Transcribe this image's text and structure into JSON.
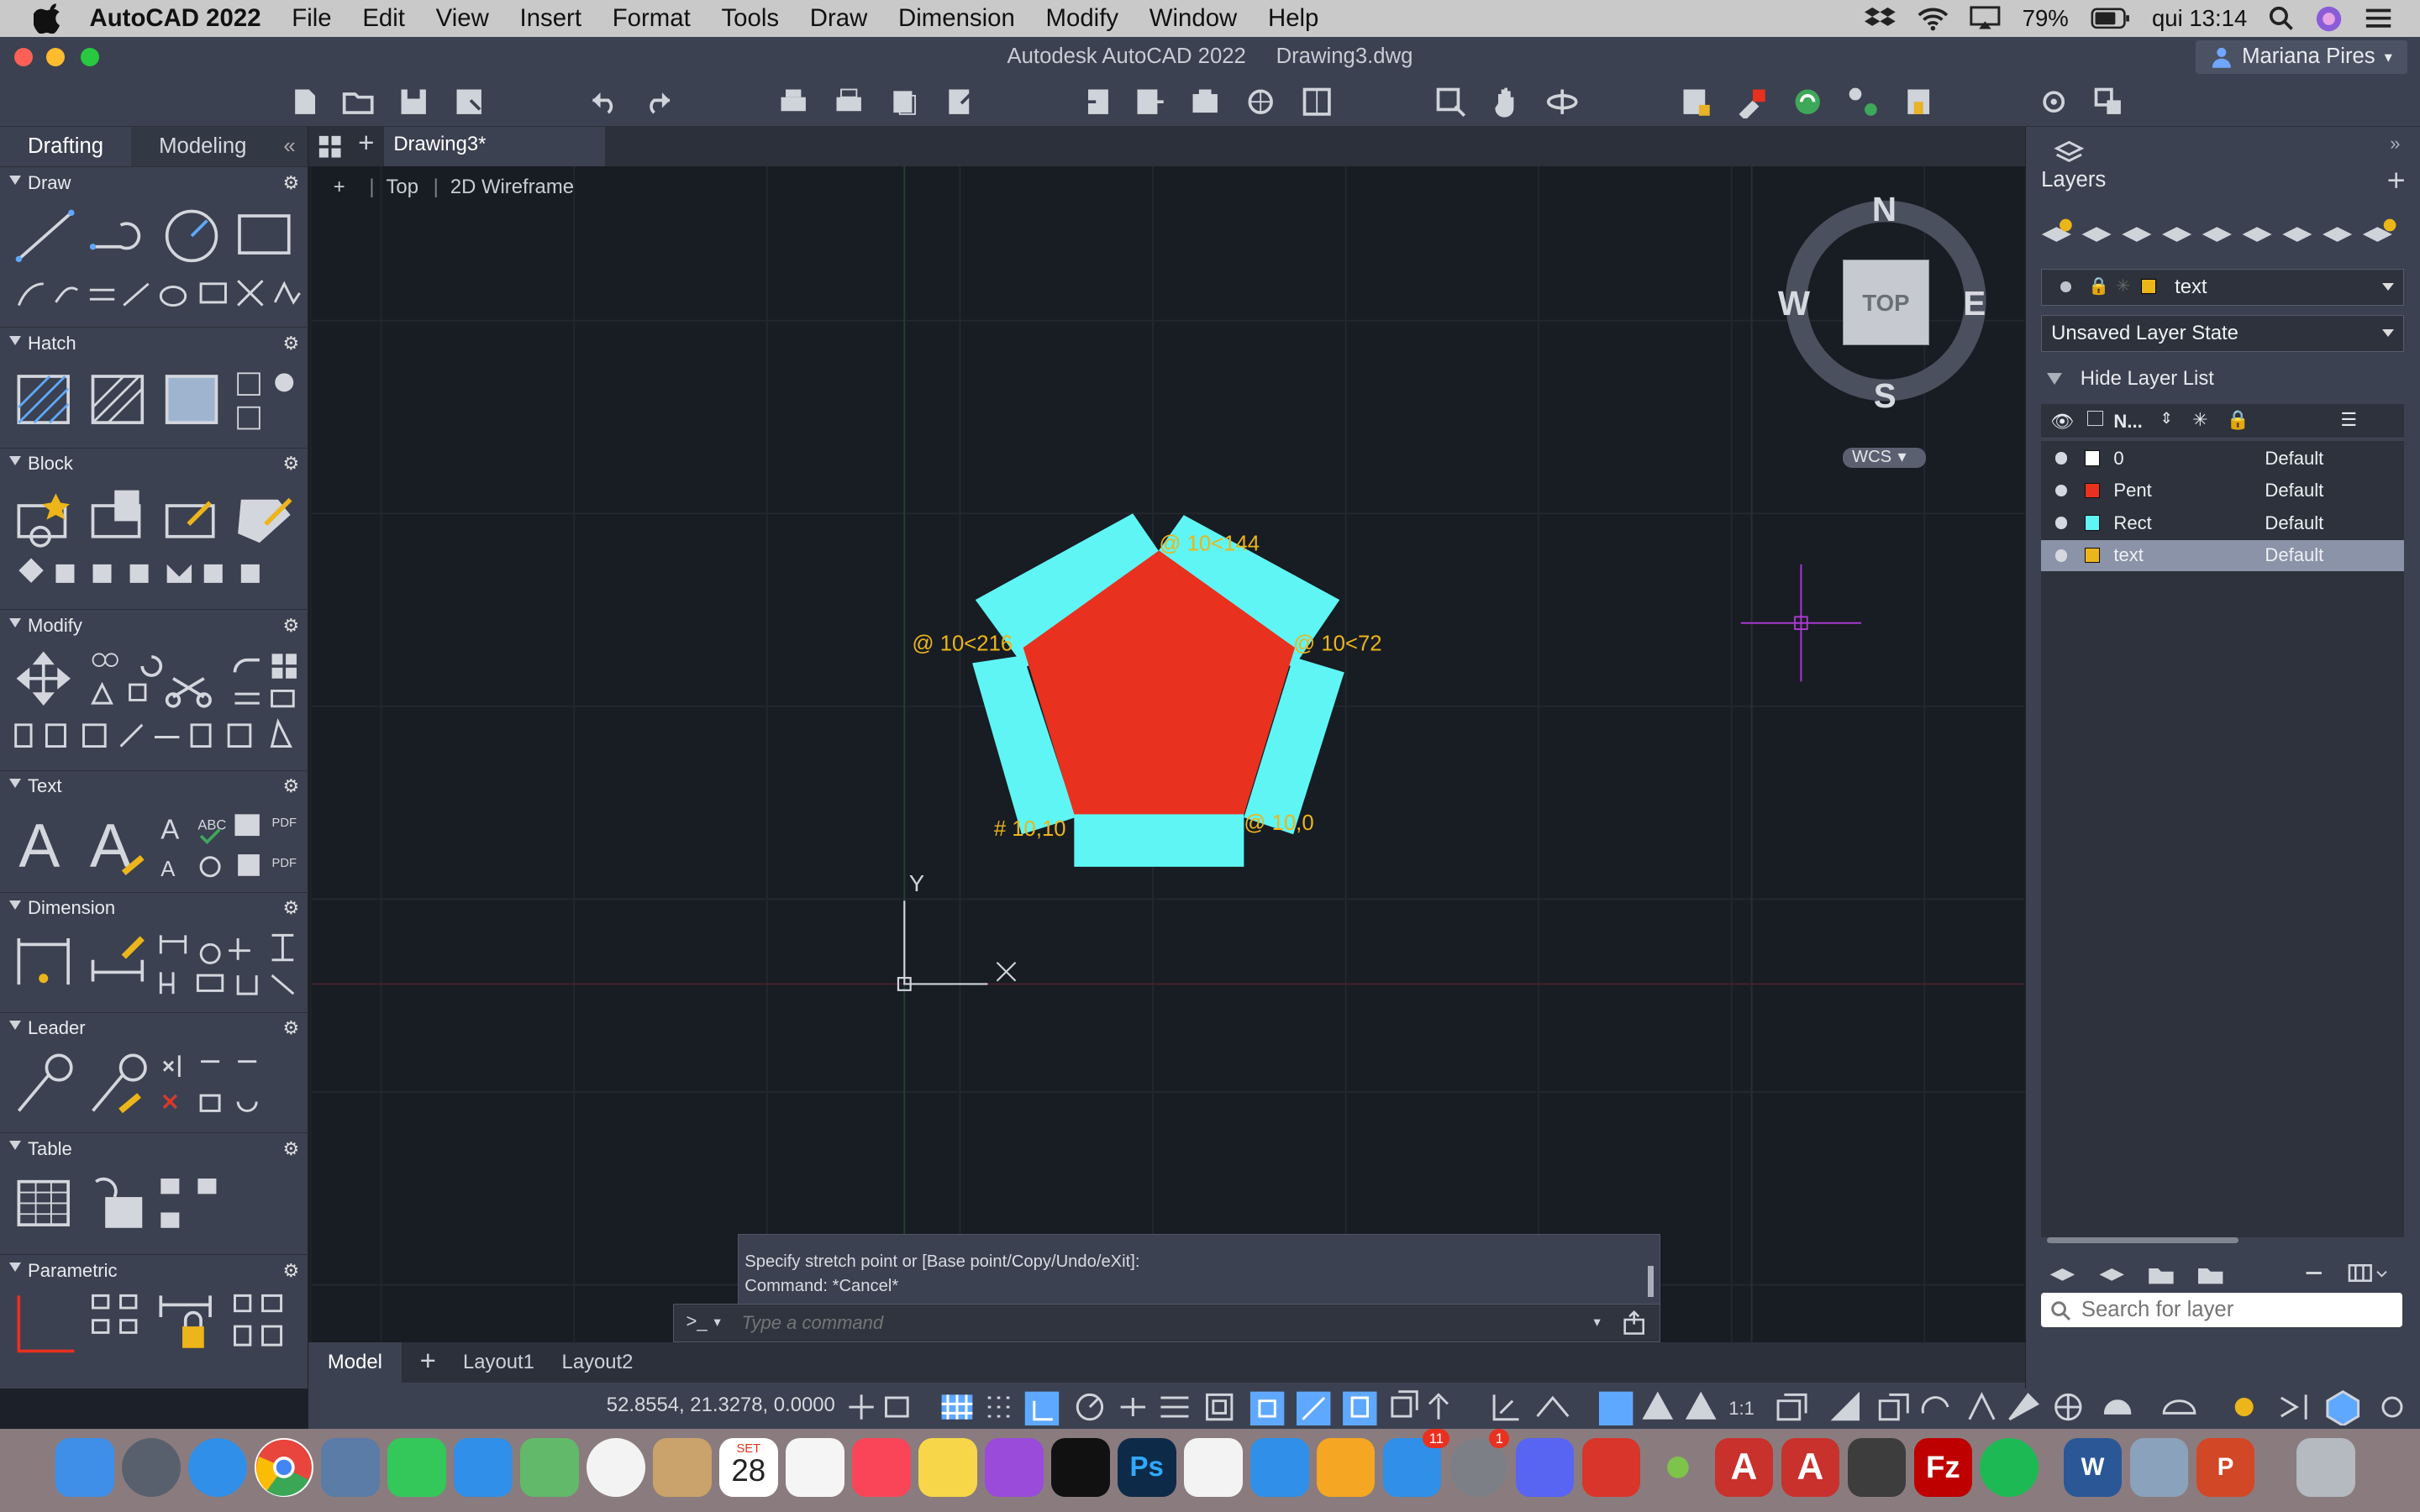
{
  "menubar": {
    "app_name": "AutoCAD 2022",
    "items": [
      "File",
      "Edit",
      "View",
      "Insert",
      "Format",
      "Tools",
      "Draw",
      "Dimension",
      "Modify",
      "Window",
      "Help"
    ],
    "battery": "79%",
    "clock": "qui 13:14"
  },
  "window": {
    "title": "Autodesk AutoCAD 2022",
    "filename": "Drawing3.dwg",
    "user": "Mariana Pires"
  },
  "palette": {
    "tabs": [
      "Drafting",
      "Modeling"
    ],
    "sections": [
      "Draw",
      "Hatch",
      "Block",
      "Modify",
      "Text",
      "Dimension",
      "Leader",
      "Table",
      "Parametric"
    ]
  },
  "doc_tab": "Drawing3*",
  "viewport": {
    "plus": "+",
    "view": "Top",
    "style": "2D Wireframe"
  },
  "viewcube": {
    "n": "N",
    "s": "S",
    "e": "E",
    "w": "W",
    "face": "TOP",
    "ucs": "WCS"
  },
  "drawing": {
    "labels": [
      "@ 10<144",
      "@ 10<216",
      "@ 10<72",
      "# 10,10",
      "@ 10,0"
    ],
    "ucs_y": "Y",
    "colors": {
      "pent_fill": "#e8311f",
      "rect_fill": "#5ff5f5",
      "label": "#ecb51a",
      "background": "#181c23"
    }
  },
  "command": {
    "line1": "Specify stretch point or [Base point/Copy/Undo/eXit]:",
    "line2": "Command: *Cancel*",
    "prompt": ">_",
    "placeholder": "Type a command"
  },
  "layout_tabs": [
    "Model",
    "Layout1",
    "Layout2"
  ],
  "status": {
    "coords": "52.8554, 21.3278, 0.0000",
    "scale": "1:1"
  },
  "layers_panel": {
    "title": "Layers",
    "current_layer": "text",
    "layer_state": "Unsaved Layer State",
    "hide_list": "Hide Layer List",
    "name_header": "N...",
    "rows": [
      {
        "name": "0",
        "color": "#ffffff",
        "linetype": "Default"
      },
      {
        "name": "Pent",
        "color": "#e8311f",
        "linetype": "Default"
      },
      {
        "name": "Rect",
        "color": "#5ff5f5",
        "linetype": "Default"
      },
      {
        "name": "text",
        "color": "#ecb51a",
        "linetype": "Default"
      }
    ],
    "selected_row": "text",
    "search_placeholder": "Search for layer"
  },
  "dock": {
    "calendar_month": "SET",
    "calendar_day": "28",
    "badge_appstore": "11",
    "badge_settings": "1"
  }
}
